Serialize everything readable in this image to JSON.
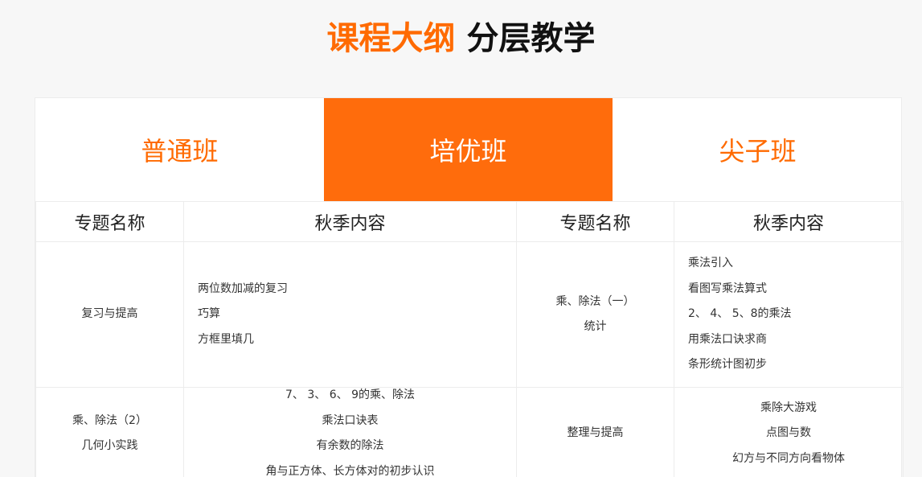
{
  "header": {
    "title_accent": "课程大纲",
    "title_rest": "分层教学"
  },
  "tabs": [
    {
      "label": "普通班",
      "active": false
    },
    {
      "label": "培优班",
      "active": true
    },
    {
      "label": "尖子班",
      "active": false
    }
  ],
  "colors": {
    "accent": "#ff6a00",
    "active_tab_bg": "#ff6c0c"
  },
  "table": {
    "headers": [
      "专题名称",
      "秋季内容",
      "专题名称",
      "秋季内容"
    ],
    "rows": [
      {
        "topic_left": [
          "复习与提高"
        ],
        "content_left": [
          "两位数加减的复习",
          "巧算",
          "方框里填几"
        ],
        "topic_right": [
          "乘、除法（一）",
          "统计"
        ],
        "content_right": [
          "乘法引入",
          "看图写乘法算式",
          "2、 4、 5、8的乘法",
          "用乘法口诀求商",
          "条形统计图初步"
        ]
      },
      {
        "topic_left": [
          "乘、除法（2）",
          "几何小实践"
        ],
        "content_left": [
          "7、 3、 6、 9的乘、除法",
          "乘法口诀表",
          "有余数的除法",
          "角与正方体、长方体对的初步认识"
        ],
        "topic_right": [
          "整理与提高"
        ],
        "content_right": [
          "乘除大游戏",
          "点图与数",
          "幻方与不同方向看物体"
        ]
      }
    ]
  }
}
